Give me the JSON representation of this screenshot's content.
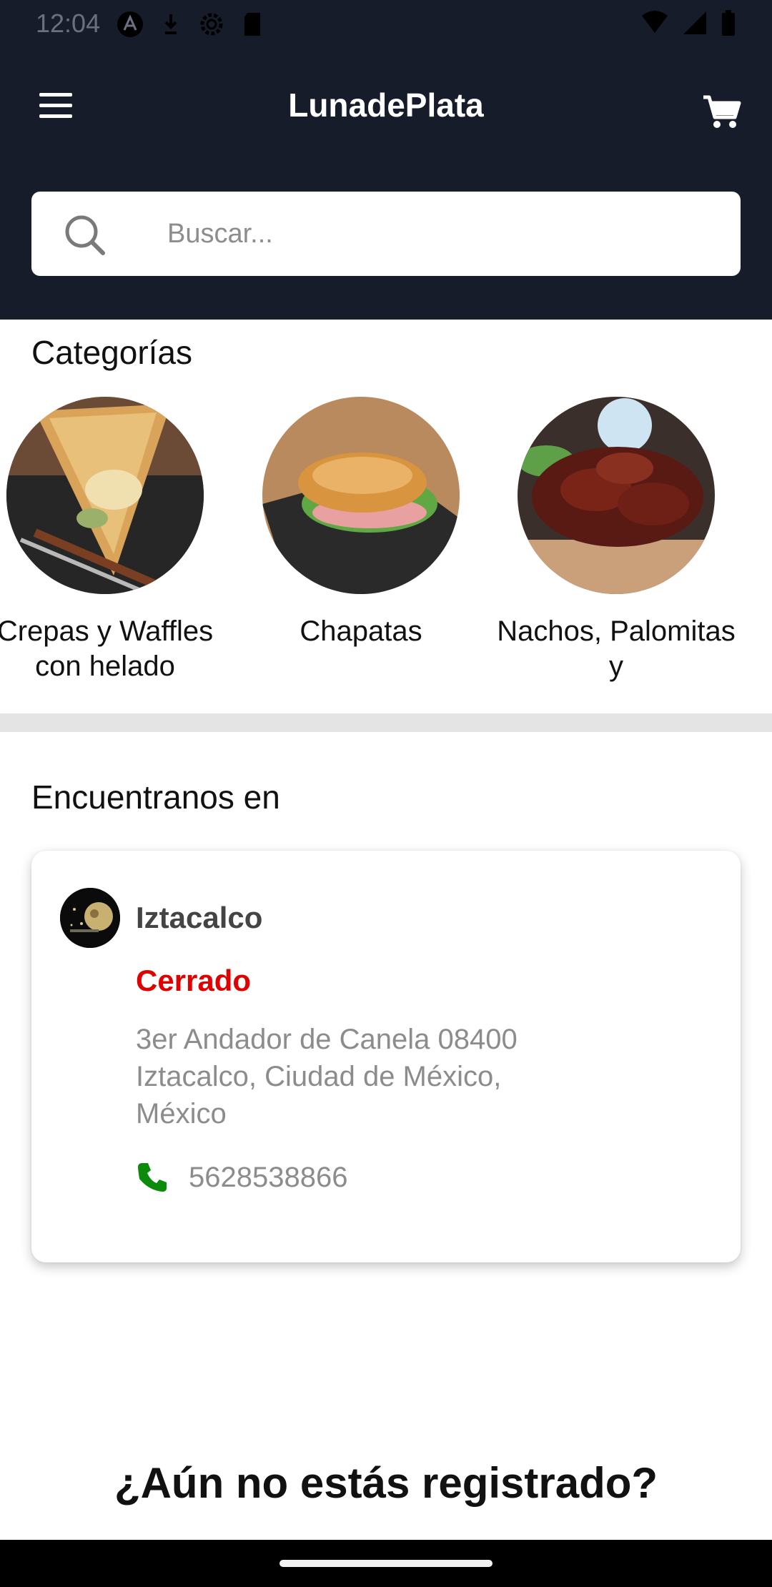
{
  "status_bar": {
    "time": "12:04"
  },
  "header": {
    "title": "LunadePlata"
  },
  "search": {
    "placeholder": "Buscar..."
  },
  "categories": {
    "title": "Categorías",
    "items": [
      {
        "label": "Crepas y Waffles con helado"
      },
      {
        "label": "Chapatas"
      },
      {
        "label": "Nachos, Palomitas y"
      }
    ]
  },
  "locations": {
    "title": "Encuentranos en",
    "card": {
      "name": "Iztacalco",
      "status": "Cerrado",
      "address": "3er Andador de Canela 08400 Iztacalco, Ciudad de México, México",
      "phone": "5628538866"
    }
  },
  "register": {
    "title": "¿Aún no estás registrado?"
  },
  "colors": {
    "header_bg": "#171c2a",
    "closed_status": "#e00000",
    "phone_icon": "#0b8a0b"
  }
}
